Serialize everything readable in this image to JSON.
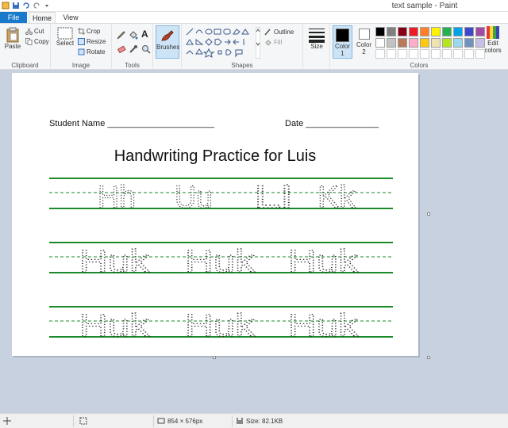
{
  "window": {
    "title": "text sample - Paint"
  },
  "tabs": {
    "file": "File",
    "home": "Home",
    "view": "View"
  },
  "ribbon": {
    "clipboard": {
      "paste": "Paste",
      "cut": "Cut",
      "copy": "Copy",
      "label": "Clipboard"
    },
    "image": {
      "select": "Select",
      "crop": "Crop",
      "resize": "Resize",
      "rotate": "Rotate",
      "label": "Image"
    },
    "tools": {
      "label": "Tools"
    },
    "brushes": {
      "label": "Brushes"
    },
    "shapes": {
      "outline": "Outline",
      "fill": "Fill",
      "label": "Shapes"
    },
    "size": {
      "label": "Size"
    },
    "colors": {
      "color1": "Color",
      "color1_num": "1",
      "color2": "Color",
      "color2_num": "2",
      "label": "Colors",
      "edit": "Edit",
      "edit2": "colors"
    }
  },
  "palette": [
    "#000000",
    "#7f7f7f",
    "#880015",
    "#ed1c24",
    "#ff7f27",
    "#fff200",
    "#22b14c",
    "#00a2e8",
    "#3f48cc",
    "#a349a4",
    "#ffffff",
    "#c3c3c3",
    "#b97a57",
    "#ffaec9",
    "#ffc90e",
    "#efe4b0",
    "#b5e61d",
    "#99d9ea",
    "#7092be",
    "#c8bfe7",
    "#ffffff",
    "#ffffff",
    "#ffffff",
    "#ffffff",
    "#ffffff",
    "#ffffff",
    "#ffffff",
    "#ffffff",
    "#ffffff",
    "#ffffff"
  ],
  "document": {
    "student_name": "Student Name ______________________",
    "date": "Date _______________",
    "heading": "Handwriting Practice for Luis",
    "rows": [
      {
        "text": "Hh  Uu  Ll  Kk"
      },
      {
        "text": "Huk  Huk  Huk"
      },
      {
        "text": "Huk  Huk  Huk"
      }
    ]
  },
  "status": {
    "dimensions": "854 × 576px",
    "size": "Size: 82.1KB"
  },
  "colors": {
    "accent": "#1979ca",
    "guideline": "#1a8a2a"
  }
}
